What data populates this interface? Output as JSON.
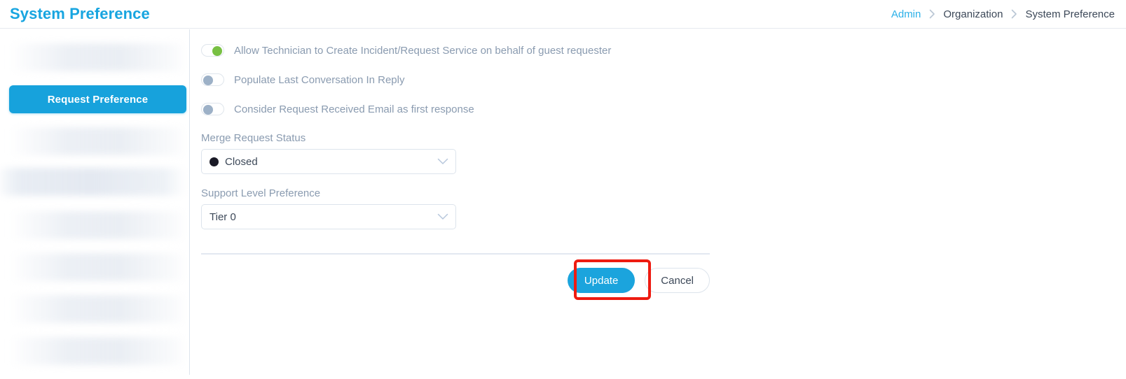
{
  "header": {
    "title": "System Preference",
    "breadcrumb": [
      {
        "label": "Admin",
        "type": "link"
      },
      {
        "label": "Organization",
        "type": "text"
      },
      {
        "label": "System Preference",
        "type": "text"
      }
    ],
    "separator_icon": "chevron-right-icon"
  },
  "sidebar": {
    "active_item": "Request Preference",
    "items": [
      {
        "label": "",
        "state": "blurred"
      },
      {
        "label": "Request Preference",
        "state": "active"
      },
      {
        "label": "",
        "state": "blurred"
      },
      {
        "label": "",
        "state": "blurred"
      },
      {
        "label": "",
        "state": "blurred"
      },
      {
        "label": "",
        "state": "blurred"
      },
      {
        "label": "",
        "state": "blurred"
      },
      {
        "label": "",
        "state": "blurred"
      },
      {
        "label": "",
        "state": "blurred"
      }
    ]
  },
  "main": {
    "toggles": [
      {
        "label": "Allow Technician to Create Incident/Request Service on behalf of guest requester",
        "state": "on",
        "icon": "toggle-switch-icon"
      },
      {
        "label": "Populate Last Conversation In Reply",
        "state": "off",
        "icon": "toggle-switch-icon"
      },
      {
        "label": "Consider Request Received Email as first response",
        "state": "off",
        "icon": "toggle-switch-icon"
      }
    ],
    "fields": [
      {
        "label": "Merge Request Status",
        "value": "Closed",
        "has_dot": true,
        "dot_color": "#1a1a26",
        "chevron_icon": "chevron-down-icon"
      },
      {
        "label": "Support Level Preference",
        "value": "Tier 0",
        "has_dot": false,
        "chevron_icon": "chevron-down-icon"
      }
    ],
    "actions": {
      "update_label": "Update",
      "cancel_label": "Cancel"
    }
  },
  "annotation": {
    "target": "Update",
    "color": "#ee1b11",
    "shape": "rectangle"
  },
  "colors": {
    "brand_blue": "#17a2dc",
    "title_blue": "#18a5e0",
    "link_blue": "#2bb0e8",
    "toggle_on_green": "#78c043",
    "toggle_off_gray": "#9db1c7",
    "label_gray": "#8a9bb0",
    "text_dark": "#3c4858",
    "border_gray": "#dde4ec",
    "annotation_red": "#ee1b11"
  }
}
